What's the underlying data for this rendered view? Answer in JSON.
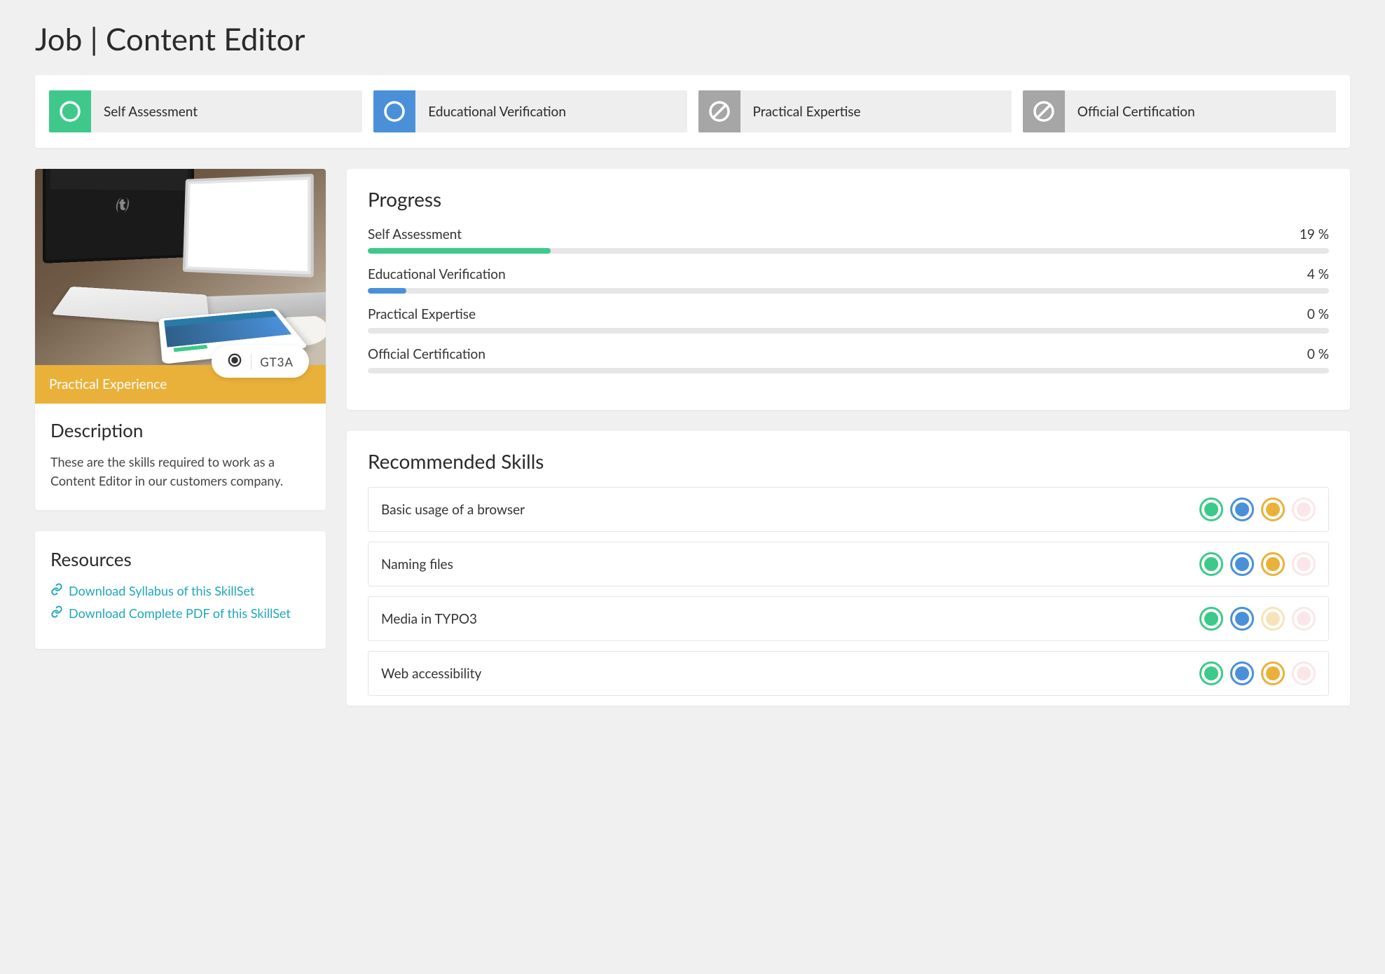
{
  "page": {
    "title": "Job | Content Editor"
  },
  "tabs": [
    {
      "label": "Self Assessment",
      "color": "green",
      "icon": "circle"
    },
    {
      "label": "Educational Verification",
      "color": "blue",
      "icon": "circle"
    },
    {
      "label": "Practical Expertise",
      "color": "grey",
      "icon": "disabled"
    },
    {
      "label": "Official Certification",
      "color": "grey",
      "icon": "disabled"
    }
  ],
  "info": {
    "banner_label": "Practical Experience",
    "badge_code": "GT3A",
    "description_heading": "Description",
    "description_text": "These are the skills required to work as a Content Editor in our customers company."
  },
  "resources": {
    "heading": "Resources",
    "links": [
      {
        "label": "Download Syllabus of this SkillSet"
      },
      {
        "label": "Download Complete PDF of this SkillSet"
      }
    ]
  },
  "progress": {
    "heading": "Progress",
    "items": [
      {
        "label": "Self Assessment",
        "pct": 19,
        "pct_label": "19 %",
        "color": "#3ec98b"
      },
      {
        "label": "Educational Verification",
        "pct": 4,
        "pct_label": "4 %",
        "color": "#4a90d9"
      },
      {
        "label": "Practical Expertise",
        "pct": 0,
        "pct_label": "0 %",
        "color": "#eab13a"
      },
      {
        "label": "Official Certification",
        "pct": 0,
        "pct_label": "0 %",
        "color": "#f1b9c0"
      }
    ]
  },
  "skills": {
    "heading": "Recommended Skills",
    "items": [
      {
        "name": "Basic usage of a browser",
        "dots": [
          "green",
          "blue",
          "yellow",
          "pink-faded"
        ]
      },
      {
        "name": "Naming files",
        "dots": [
          "green",
          "blue",
          "yellow",
          "pink-faded"
        ]
      },
      {
        "name": "Media in TYPO3",
        "dots": [
          "green",
          "blue",
          "yellow-faded",
          "pink-faded"
        ]
      },
      {
        "name": "Web accessibility",
        "dots": [
          "green",
          "blue",
          "yellow",
          "pink-faded"
        ]
      }
    ]
  }
}
